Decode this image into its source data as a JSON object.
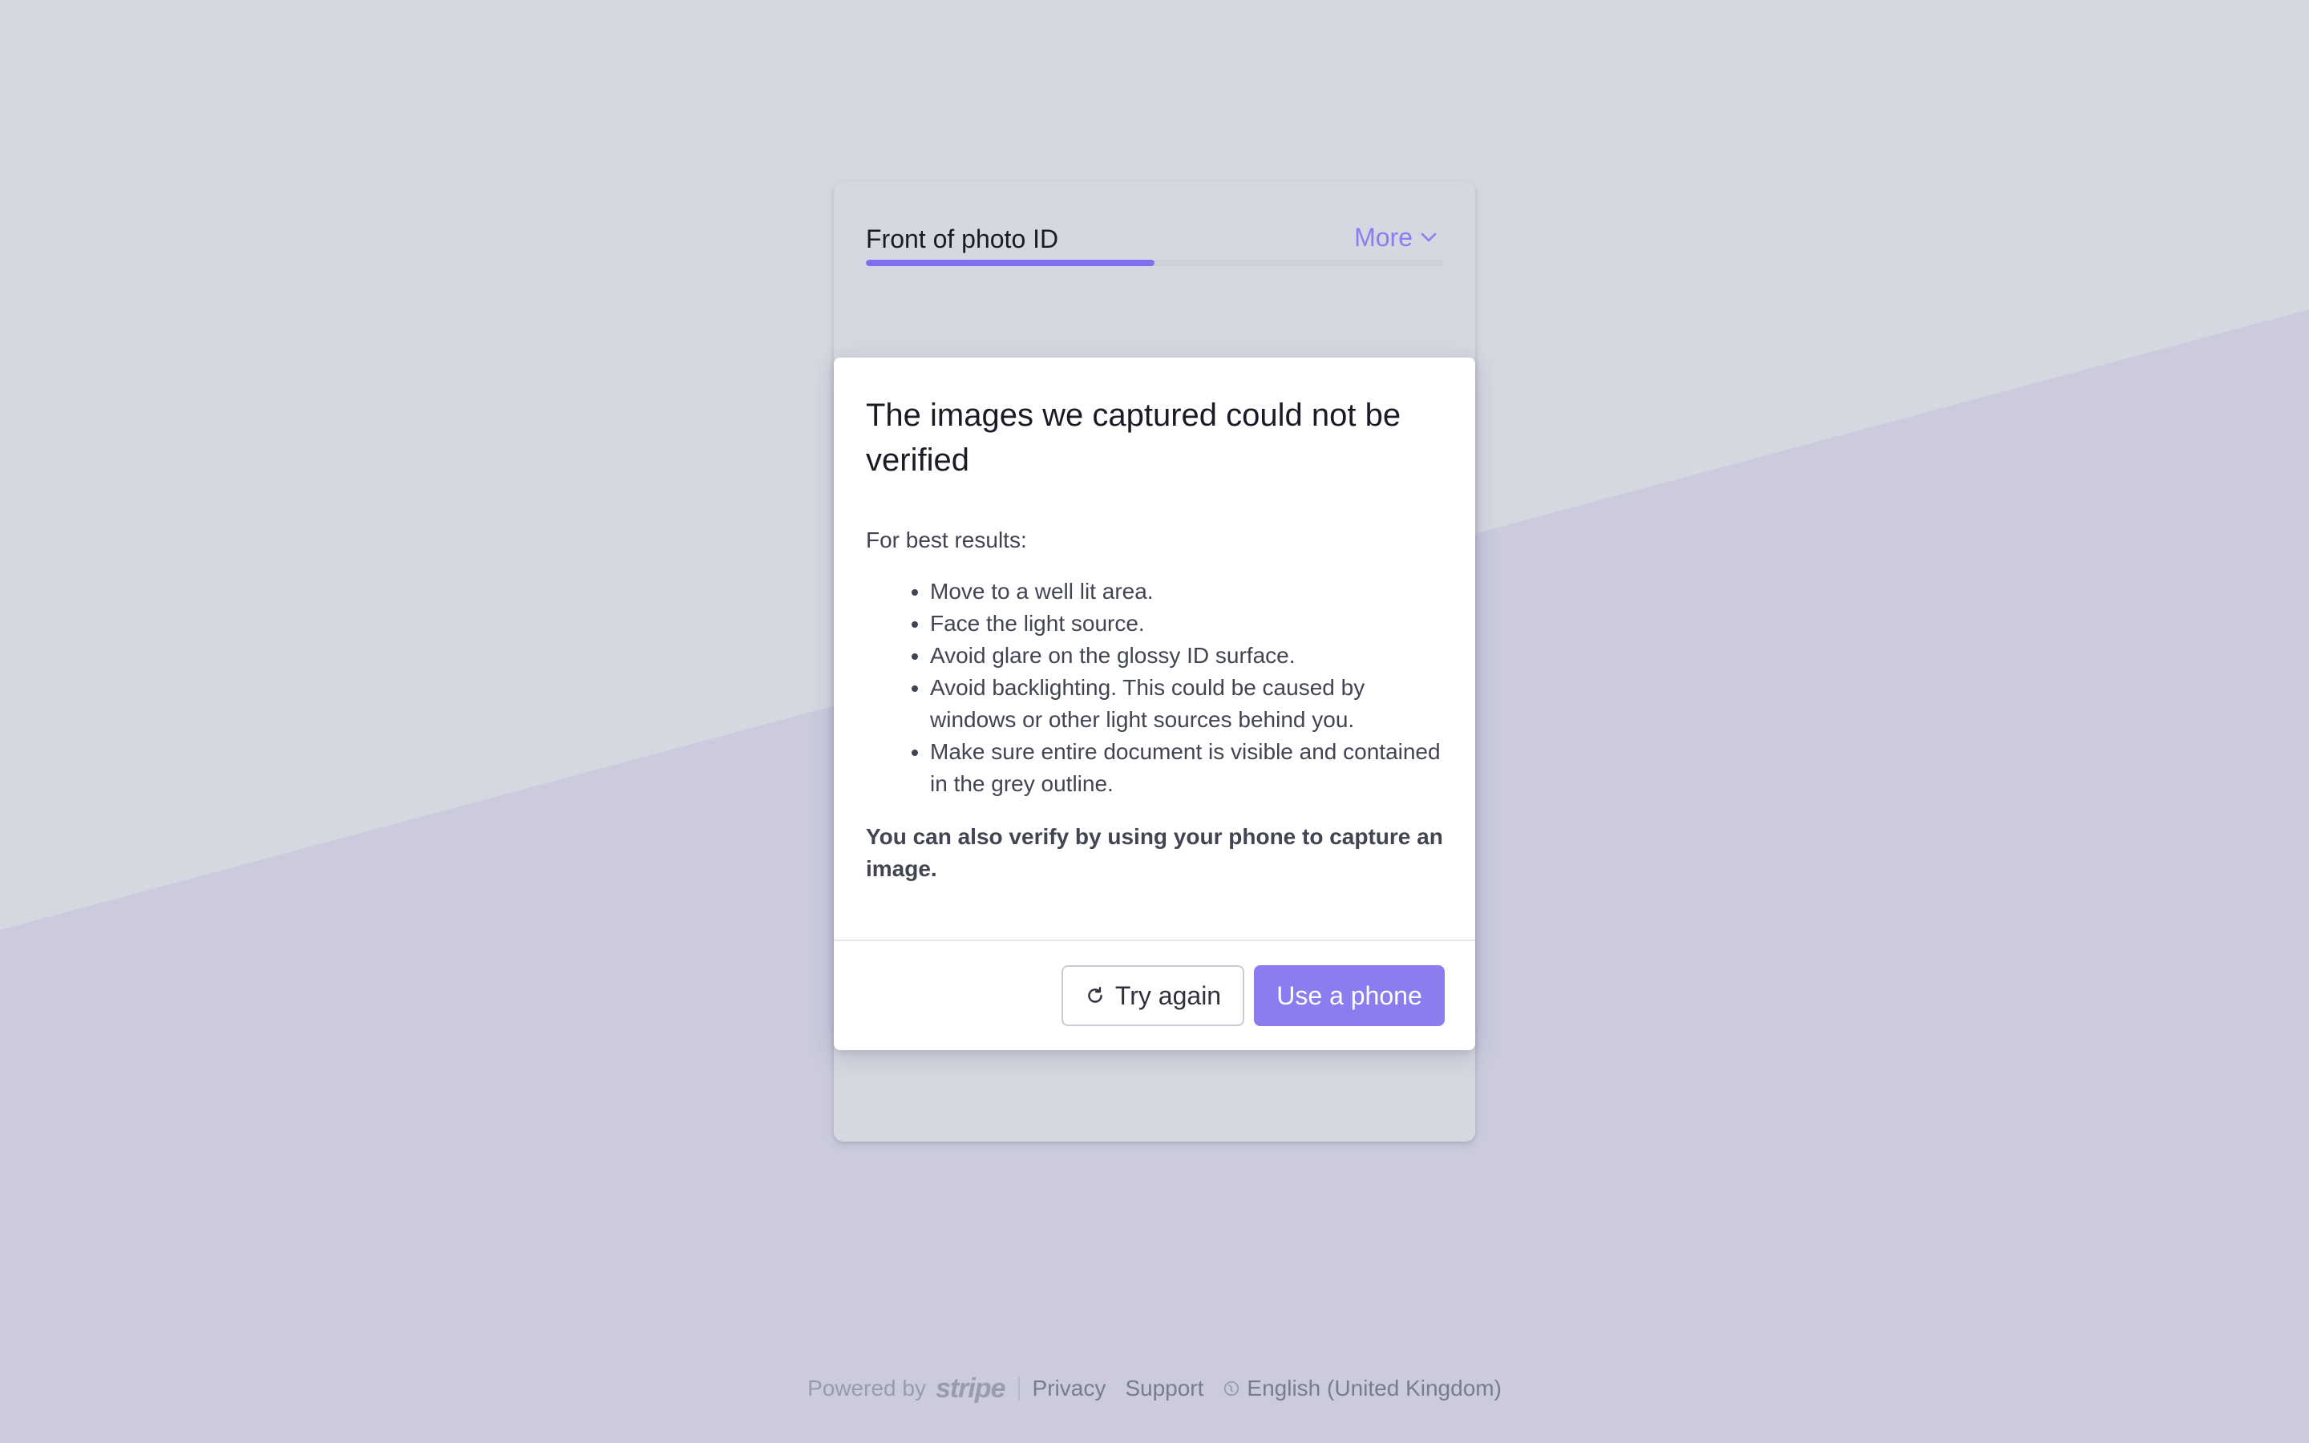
{
  "header": {
    "title": "Front of photo ID",
    "more_label": "More",
    "progress": 0.5
  },
  "dialog": {
    "heading": "The images we captured could not be verified",
    "intro": "For best results:",
    "tips": [
      "Move to a well lit area.",
      "Face the light source.",
      "Avoid glare on the glossy ID surface.",
      "Avoid backlighting. This could be caused by windows or other light sources behind you.",
      "Make sure entire document is visible and contained in the grey outline."
    ],
    "alt_text": "You can also verify by using your phone to capture an image.",
    "try_again_label": "Try again",
    "use_phone_label": "Use a phone"
  },
  "footer": {
    "powered_by": "Powered by",
    "brand": "stripe",
    "privacy": "Privacy",
    "support": "Support",
    "language": "English (United Kingdom)"
  },
  "colors": {
    "accent": "#8b7df0",
    "progress": "#7e6ff0",
    "background_light": "#d5d8e0",
    "background_diagonal": "#cbcbdd"
  },
  "icons": {
    "more": "chevron-down-icon",
    "try_again": "refresh-icon",
    "language": "globe-icon"
  }
}
